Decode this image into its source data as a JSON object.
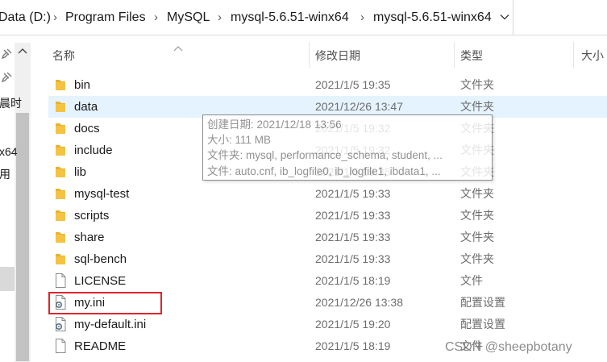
{
  "address_bar": {
    "crumbs": [
      "Data (D:)",
      "Program Files",
      "MySQL",
      "mysql-5.6.51-winx64",
      "mysql-5.6.51-winx64"
    ]
  },
  "nav_pane": {
    "items": [
      "晨时",
      "x64",
      "用"
    ]
  },
  "columns": {
    "name": "名称",
    "date_modified": "修改日期",
    "type": "类型",
    "size": "大小"
  },
  "files": [
    {
      "name": "bin",
      "date": "2021/1/5 19:35",
      "type": "文件夹",
      "icon": "folder-icon"
    },
    {
      "name": "data",
      "date": "2021/12/26 13:47",
      "type": "文件夹",
      "icon": "folder-icon"
    },
    {
      "name": "docs",
      "date": "2021/1/5 19:32",
      "type": "文件夹",
      "icon": "folder-icon"
    },
    {
      "name": "include",
      "date": "2021/1/5 19:32",
      "type": "文件夹",
      "icon": "folder-icon"
    },
    {
      "name": "lib",
      "date": "2021/1/5 19:35",
      "type": "文件夹",
      "icon": "folder-icon"
    },
    {
      "name": "mysql-test",
      "date": "2021/1/5 19:33",
      "type": "文件夹",
      "icon": "folder-icon"
    },
    {
      "name": "scripts",
      "date": "2021/1/5 19:33",
      "type": "文件夹",
      "icon": "folder-icon"
    },
    {
      "name": "share",
      "date": "2021/1/5 19:33",
      "type": "文件夹",
      "icon": "folder-icon"
    },
    {
      "name": "sql-bench",
      "date": "2021/1/5 19:33",
      "type": "文件夹",
      "icon": "folder-icon"
    },
    {
      "name": "LICENSE",
      "date": "2021/1/5 18:19",
      "type": "文件",
      "icon": "file-icon"
    },
    {
      "name": "my.ini",
      "date": "2021/12/26 13:38",
      "type": "配置设置",
      "icon": "config-file-icon"
    },
    {
      "name": "my-default.ini",
      "date": "2021/1/5 19:20",
      "type": "配置设置",
      "icon": "config-file-icon"
    },
    {
      "name": "README",
      "date": "2021/1/5 18:19",
      "type": "文件",
      "icon": "file-icon"
    }
  ],
  "tooltip": {
    "created": "创建日期: 2021/12/18 13:56",
    "size": "大小: 111 MB",
    "folders": "文件夹: mysql, performance_schema, student, ...",
    "files": "文件: auto.cnf, ib_logfile0, ib_logfile1, ibdata1, ..."
  },
  "watermark": "CSDN @sheepbotany",
  "colors": {
    "folder": "#f5c342",
    "hover_row": "#e5f3ff",
    "highlight_border": "#e0242b"
  }
}
